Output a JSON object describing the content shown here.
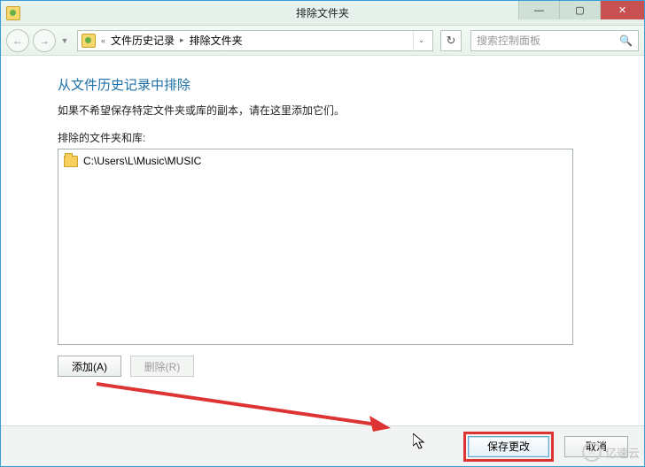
{
  "titlebar": {
    "title": "排除文件夹"
  },
  "breadcrumb": {
    "prefix": "«",
    "seg1": "文件历史记录",
    "seg2": "排除文件夹"
  },
  "search": {
    "placeholder": "搜索控制面板"
  },
  "main": {
    "heading": "从文件历史记录中排除",
    "desc": "如果不希望保存特定文件夹或库的副本，请在这里添加它们。",
    "list_label": "排除的文件夹和库:",
    "items": [
      {
        "path": "C:\\Users\\L\\Music\\MUSIC"
      }
    ],
    "add_label": "添加(A)",
    "remove_label": "删除(R)"
  },
  "footer": {
    "save_label": "保存更改",
    "cancel_label": "取消"
  },
  "watermark": {
    "text": "亿速云"
  }
}
